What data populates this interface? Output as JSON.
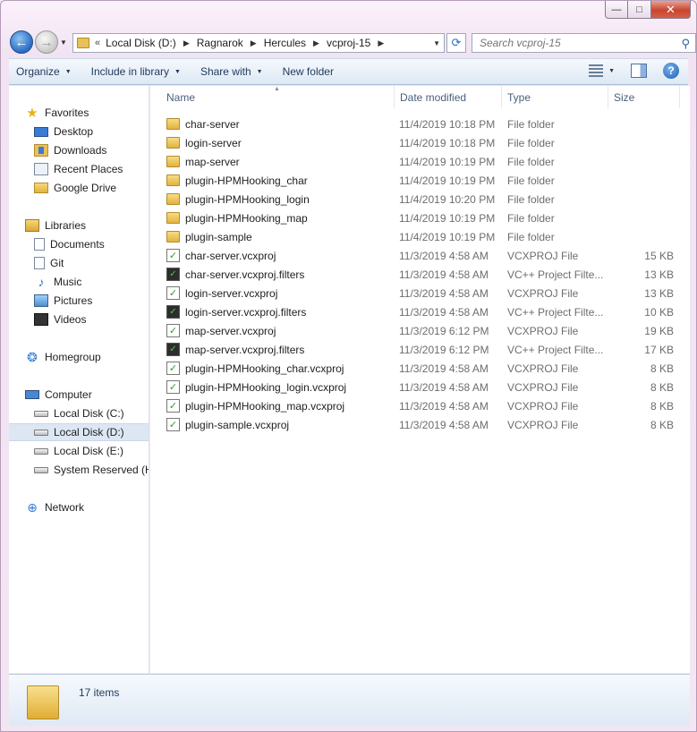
{
  "window": {
    "caption": {
      "min": "—",
      "max": "□",
      "close": "✕"
    }
  },
  "nav": {
    "back": "←",
    "forward": "→",
    "chevron": "«",
    "breadcrumbs": [
      "Local Disk (D:)",
      "Ragnarok",
      "Hercules",
      "vcproj-15"
    ],
    "refresh": "⟳",
    "search_placeholder": "Search vcproj-15"
  },
  "toolbar": {
    "organize": "Organize",
    "include_in_library": "Include in library",
    "share_with": "Share with",
    "new_folder": "New folder",
    "help": "?"
  },
  "sidebar": {
    "items": [
      {
        "label": "Favorites",
        "icon": "star-icon",
        "level": "top"
      },
      {
        "label": "Desktop",
        "icon": "desktop-icon",
        "level": "sub"
      },
      {
        "label": "Downloads",
        "icon": "downloads-icon",
        "level": "sub"
      },
      {
        "label": "Recent Places",
        "icon": "recent-places-icon",
        "level": "sub"
      },
      {
        "label": "Google Drive",
        "icon": "google-drive-icon",
        "level": "sub"
      },
      {
        "label": "Libraries",
        "icon": "libraries-icon",
        "level": "top"
      },
      {
        "label": "Documents",
        "icon": "documents-icon",
        "level": "sub"
      },
      {
        "label": "Git",
        "icon": "git-icon",
        "level": "sub"
      },
      {
        "label": "Music",
        "icon": "music-icon",
        "level": "sub"
      },
      {
        "label": "Pictures",
        "icon": "pictures-icon",
        "level": "sub"
      },
      {
        "label": "Videos",
        "icon": "videos-icon",
        "level": "sub"
      },
      {
        "label": "Homegroup",
        "icon": "homegroup-icon",
        "level": "top"
      },
      {
        "label": "Computer",
        "icon": "computer-icon",
        "level": "top"
      },
      {
        "label": "Local Disk (C:)",
        "icon": "drive-icon",
        "level": "sub"
      },
      {
        "label": "Local Disk (D:)",
        "icon": "drive-icon",
        "level": "sub",
        "selected": true
      },
      {
        "label": "Local Disk (E:)",
        "icon": "drive-icon",
        "level": "sub"
      },
      {
        "label": "System Reserved (H:",
        "icon": "drive-icon",
        "level": "sub"
      },
      {
        "label": "Network",
        "icon": "network-icon",
        "level": "top"
      }
    ]
  },
  "columns": {
    "name": "Name",
    "date": "Date modified",
    "type": "Type",
    "size": "Size"
  },
  "files": [
    {
      "name": "char-server",
      "date": "11/4/2019 10:18 PM",
      "type": "File folder",
      "size": "",
      "icon": "folder-icon"
    },
    {
      "name": "login-server",
      "date": "11/4/2019 10:18 PM",
      "type": "File folder",
      "size": "",
      "icon": "folder-icon"
    },
    {
      "name": "map-server",
      "date": "11/4/2019 10:19 PM",
      "type": "File folder",
      "size": "",
      "icon": "folder-icon"
    },
    {
      "name": "plugin-HPMHooking_char",
      "date": "11/4/2019 10:19 PM",
      "type": "File folder",
      "size": "",
      "icon": "folder-icon"
    },
    {
      "name": "plugin-HPMHooking_login",
      "date": "11/4/2019 10:20 PM",
      "type": "File folder",
      "size": "",
      "icon": "folder-icon"
    },
    {
      "name": "plugin-HPMHooking_map",
      "date": "11/4/2019 10:19 PM",
      "type": "File folder",
      "size": "",
      "icon": "folder-icon"
    },
    {
      "name": "plugin-sample",
      "date": "11/4/2019 10:19 PM",
      "type": "File folder",
      "size": "",
      "icon": "folder-icon"
    },
    {
      "name": "char-server.vcxproj",
      "date": "11/3/2019 4:58 AM",
      "type": "VCXPROJ File",
      "size": "15 KB",
      "icon": "vcxproj-icon"
    },
    {
      "name": "char-server.vcxproj.filters",
      "date": "11/3/2019 4:58 AM",
      "type": "VC++ Project Filte...",
      "size": "13 KB",
      "icon": "filters-icon"
    },
    {
      "name": "login-server.vcxproj",
      "date": "11/3/2019 4:58 AM",
      "type": "VCXPROJ File",
      "size": "13 KB",
      "icon": "vcxproj-icon"
    },
    {
      "name": "login-server.vcxproj.filters",
      "date": "11/3/2019 4:58 AM",
      "type": "VC++ Project Filte...",
      "size": "10 KB",
      "icon": "filters-icon"
    },
    {
      "name": "map-server.vcxproj",
      "date": "11/3/2019 6:12 PM",
      "type": "VCXPROJ File",
      "size": "19 KB",
      "icon": "vcxproj-icon"
    },
    {
      "name": "map-server.vcxproj.filters",
      "date": "11/3/2019 6:12 PM",
      "type": "VC++ Project Filte...",
      "size": "17 KB",
      "icon": "filters-icon"
    },
    {
      "name": "plugin-HPMHooking_char.vcxproj",
      "date": "11/3/2019 4:58 AM",
      "type": "VCXPROJ File",
      "size": "8 KB",
      "icon": "vcxproj-icon"
    },
    {
      "name": "plugin-HPMHooking_login.vcxproj",
      "date": "11/3/2019 4:58 AM",
      "type": "VCXPROJ File",
      "size": "8 KB",
      "icon": "vcxproj-icon"
    },
    {
      "name": "plugin-HPMHooking_map.vcxproj",
      "date": "11/3/2019 4:58 AM",
      "type": "VCXPROJ File",
      "size": "8 KB",
      "icon": "vcxproj-icon"
    },
    {
      "name": "plugin-sample.vcxproj",
      "date": "11/3/2019 4:58 AM",
      "type": "VCXPROJ File",
      "size": "8 KB",
      "icon": "vcxproj-icon"
    }
  ],
  "status": {
    "item_count": "17 items"
  }
}
